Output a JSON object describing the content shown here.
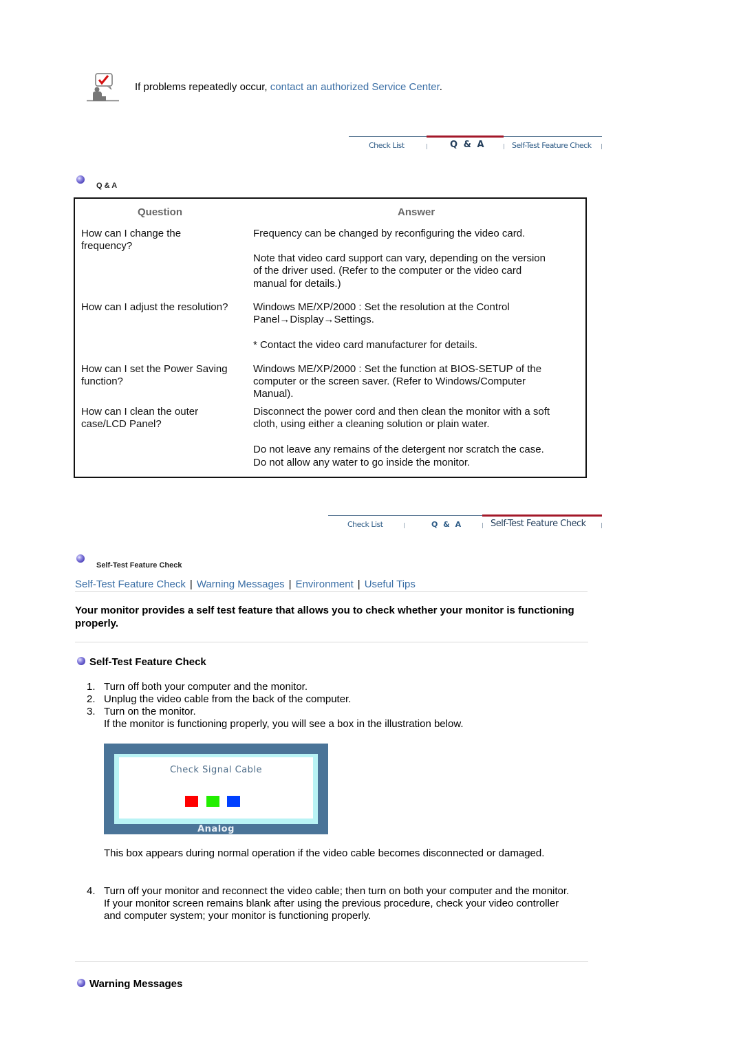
{
  "notice": {
    "icon": "help-person-checkmark-icon",
    "text_prefix": "If problems repeatedly occur, ",
    "link_text": "contact an authorized Service Center",
    "text_suffix": "."
  },
  "tabstrip_top": {
    "tabs": [
      {
        "label": "Check List",
        "active": false
      },
      {
        "label": "Q & A",
        "active": true
      },
      {
        "label": "Self-Test Feature Check",
        "active": false
      }
    ]
  },
  "qa_section": {
    "bullet_icon": "purple-orb-bullet-icon",
    "heading": "Q & A",
    "table": {
      "headers": [
        "Question",
        "Answer"
      ],
      "rows": [
        {
          "question": [
            "How can I change the",
            "frequency?"
          ],
          "answers": [
            [
              "Frequency can be changed by reconfiguring the video card."
            ],
            [
              "Note that video card support can vary, depending on the version",
              "of the driver used. (Refer to the computer or the video card",
              "manual for details.)"
            ]
          ]
        },
        {
          "question": [
            "How can I adjust the resolution?"
          ],
          "answers": [
            [
              "Windows ME/XP/2000 : Set the resolution at the Control",
              "Panel→Display→Settings."
            ],
            [
              "* Contact the video card manufacturer for details."
            ]
          ]
        },
        {
          "question": [
            "How can I set the Power Saving",
            "function?"
          ],
          "answers": [
            [
              "Windows ME/XP/2000 : Set the function at BIOS-SETUP of the",
              "computer or the screen saver. (Refer to Windows/Computer",
              "Manual)."
            ]
          ]
        },
        {
          "question": [
            "How can I clean the outer",
            "case/LCD Panel?"
          ],
          "answers": [
            [
              "Disconnect the power cord and then clean the monitor with a soft",
              "cloth, using either a cleaning solution or plain water."
            ],
            [
              "Do not leave any remains of the detergent nor scratch the case.",
              "Do not allow any water to go inside the monitor."
            ]
          ]
        }
      ]
    }
  },
  "tabstrip_bottom": {
    "tabs": [
      {
        "label": "Check List",
        "active": false
      },
      {
        "label": "Q & A",
        "active": false
      },
      {
        "label": "Self-Test Feature Check",
        "active": true
      }
    ]
  },
  "selftest_section": {
    "bullet_icon": "purple-orb-bullet-icon",
    "heading": "Self-Test Feature Check",
    "subnav": [
      "Self-Test Feature Check",
      "Warning Messages",
      "Environment",
      "Useful Tips"
    ],
    "intro": "Your monitor provides a self test feature that allows you to check whether your monitor is functioning properly.",
    "title": "Self-Test Feature Check",
    "steps": [
      {
        "num": "1.",
        "text": "Turn off both your computer and the monitor."
      },
      {
        "num": "2.",
        "text": "Unplug the video cable from the back of the computer."
      },
      {
        "num": "3.",
        "text": "Turn on the monitor.",
        "note": "If the monitor is functioning properly, you will see a box in the illustration below."
      }
    ],
    "illustration": {
      "title": "Check Signal Cable",
      "footer": "Analog",
      "swatch_colors": [
        "#ff0000",
        "#22ee00",
        "#0040ff"
      ]
    },
    "illustration_caption": "This box appears during normal operation if the video cable becomes disconnected or damaged.",
    "step4": {
      "num": "4.",
      "text": "Turn off your monitor and reconnect the video cable; then turn on both your computer and the monitor.",
      "note": "If your monitor screen remains blank after using the previous procedure, check your video controller and computer system; your monitor is functioning properly."
    }
  },
  "warning_section": {
    "bullet_icon": "purple-orb-bullet-icon",
    "title": "Warning Messages"
  },
  "colors": {
    "link": "#3a6ea5",
    "active_tab_bar": "#a31829",
    "illustration_frame": "#4a7498"
  }
}
